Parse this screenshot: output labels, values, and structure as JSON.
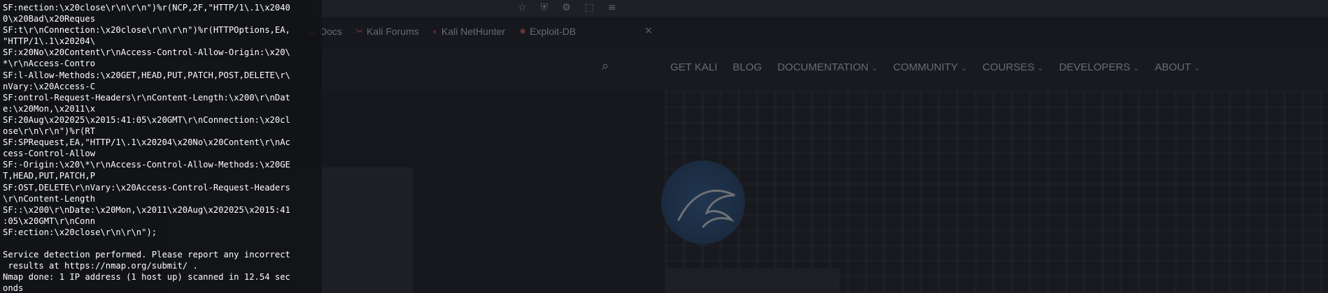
{
  "browser": {
    "toolbar_icons": [
      "☆",
      "⛨",
      "⚙",
      "⬚",
      "≡"
    ],
    "bookmarks": [
      {
        "icon": "☁",
        "label": "Docs"
      },
      {
        "icon": "✂",
        "label": "Kali Forums"
      },
      {
        "icon": "◐",
        "label": "Kali NetHunter"
      },
      {
        "icon": "✹",
        "label": "Exploit-DB"
      }
    ],
    "corner_close": "×",
    "search_icon": "⌕",
    "nav_menu": [
      {
        "label": "GET KALI",
        "dropdown": false
      },
      {
        "label": "BLOG",
        "dropdown": false
      },
      {
        "label": "DOCUMENTATION",
        "dropdown": true
      },
      {
        "label": "COMMUNITY",
        "dropdown": true
      },
      {
        "label": "COURSES",
        "dropdown": true
      },
      {
        "label": "DEVELOPERS",
        "dropdown": true
      },
      {
        "label": "ABOUT",
        "dropdown": true
      }
    ],
    "chevron": "⌄"
  },
  "terminal": {
    "lines": [
      "SF:nection:\\x20close\\r\\n\\r\\n\")%r(NCP,2F,\"HTTP/1\\.1\\x2040",
      "0\\x20Bad\\x20Reques",
      "SF:t\\r\\nConnection:\\x20close\\r\\n\\r\\n\")%r(HTTPOptions,EA,",
      "\"HTTP/1\\.1\\x20204\\",
      "SF:x20No\\x20Content\\r\\nAccess-Control-Allow-Origin:\\x20\\",
      "*\\r\\nAccess-Contro",
      "SF:l-Allow-Methods:\\x20GET,HEAD,PUT,PATCH,POST,DELETE\\r\\",
      "nVary:\\x20Access-C",
      "SF:ontrol-Request-Headers\\r\\nContent-Length:\\x200\\r\\nDat",
      "e:\\x20Mon,\\x2011\\x",
      "SF:20Aug\\x202025\\x2015:41:05\\x20GMT\\r\\nConnection:\\x20cl",
      "ose\\r\\n\\r\\n\")%r(RT",
      "SF:SPRequest,EA,\"HTTP/1\\.1\\x20204\\x20No\\x20Content\\r\\nAc",
      "cess-Control-Allow",
      "SF:-Origin:\\x20\\*\\r\\nAccess-Control-Allow-Methods:\\x20GE",
      "T,HEAD,PUT,PATCH,P",
      "SF:OST,DELETE\\r\\nVary:\\x20Access-Control-Request-Headers",
      "\\r\\nContent-Length",
      "SF::\\x200\\r\\nDate:\\x20Mon,\\x2011\\x20Aug\\x202025\\x2015:41",
      ":05\\x20GMT\\r\\nConn",
      "SF:ection:\\x20close\\r\\n\\r\\n\");",
      "",
      "Service detection performed. Please report any incorrect",
      " results at https://nmap.org/submit/ .",
      "Nmap done: 1 IP address (1 host up) scanned in 12.54 sec",
      "onds"
    ]
  }
}
